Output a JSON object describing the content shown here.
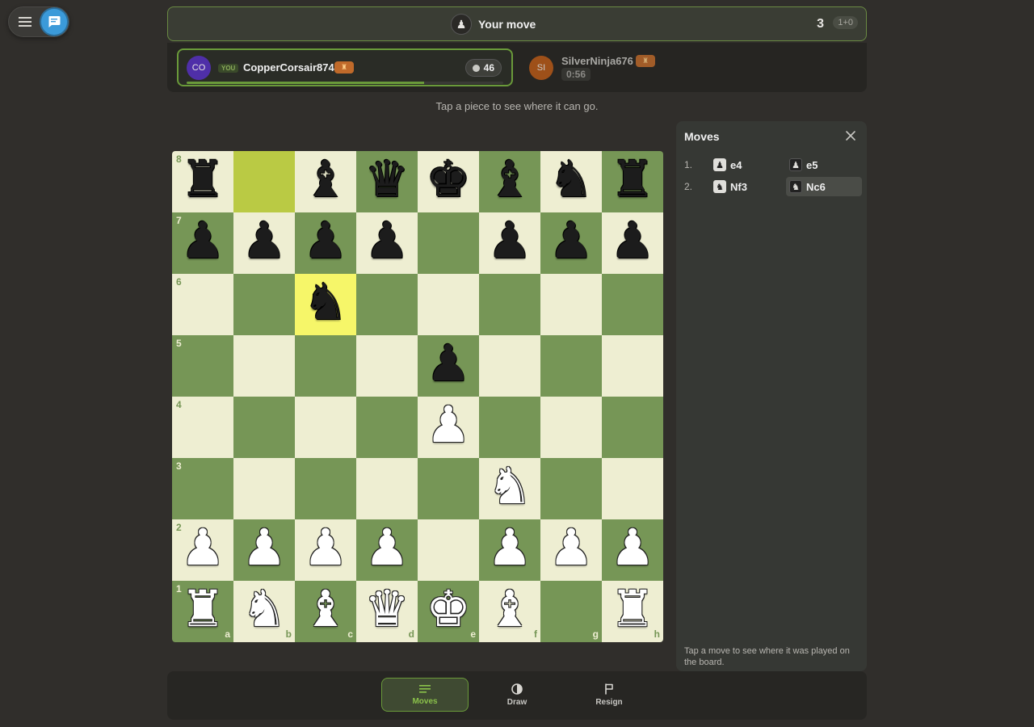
{
  "status": {
    "text": "Your move",
    "move_number": "3",
    "time_control": "1+0"
  },
  "me": {
    "avatar": "CO",
    "you_label": "YOU",
    "name": "CopperCorsair874",
    "coins": "46",
    "time_progress": 0.75
  },
  "opponent": {
    "avatar": "SI",
    "name": "SilverNinja676",
    "timer": "0:56"
  },
  "hint": "Tap a piece to see where it can go.",
  "board": {
    "ranks": [
      "8",
      "7",
      "6",
      "5",
      "4",
      "3",
      "2",
      "1"
    ],
    "files": [
      "a",
      "b",
      "c",
      "d",
      "e",
      "f",
      "g",
      "h"
    ],
    "position": [
      [
        "br",
        "",
        "bb",
        "bq",
        "bk",
        "bb",
        "bn",
        "br"
      ],
      [
        "bp",
        "bp",
        "bp",
        "bp",
        "",
        "bp",
        "bp",
        "bp"
      ],
      [
        "",
        "",
        "bn",
        "",
        "",
        "",
        "",
        ""
      ],
      [
        "",
        "",
        "",
        "",
        "bp",
        "",
        "",
        ""
      ],
      [
        "",
        "",
        "",
        "",
        "wp",
        "",
        "",
        ""
      ],
      [
        "",
        "",
        "",
        "",
        "",
        "wn",
        "",
        ""
      ],
      [
        "wp",
        "wp",
        "wp",
        "wp",
        "",
        "wp",
        "wp",
        "wp"
      ],
      [
        "wr",
        "wn",
        "wb",
        "wq",
        "wk",
        "wb",
        "",
        "wr"
      ]
    ],
    "last_move_from": "b8",
    "last_move_to": "c6",
    "colors": {
      "light": "#eeeed2",
      "dark": "#769656",
      "highlight_to": "#f6f669",
      "highlight_from": "#baca44"
    }
  },
  "moves_panel": {
    "title": "Moves",
    "moves": [
      {
        "num": "1.",
        "white": "e4",
        "white_piece": "pawn",
        "black": "e5",
        "black_piece": "pawn"
      },
      {
        "num": "2.",
        "white": "Nf3",
        "white_piece": "knight",
        "black": "Nc6",
        "black_piece": "knight"
      }
    ],
    "footer": "Tap a move to see where it was played on the board."
  },
  "actions": [
    {
      "id": "moves",
      "label": "Moves",
      "icon": "moves-list-icon",
      "active": true
    },
    {
      "id": "draw",
      "label": "Draw",
      "icon": "draw-icon",
      "active": false
    },
    {
      "id": "resign",
      "label": "Resign",
      "icon": "flag-icon",
      "active": false
    }
  ],
  "accent": "#6a9a3a"
}
